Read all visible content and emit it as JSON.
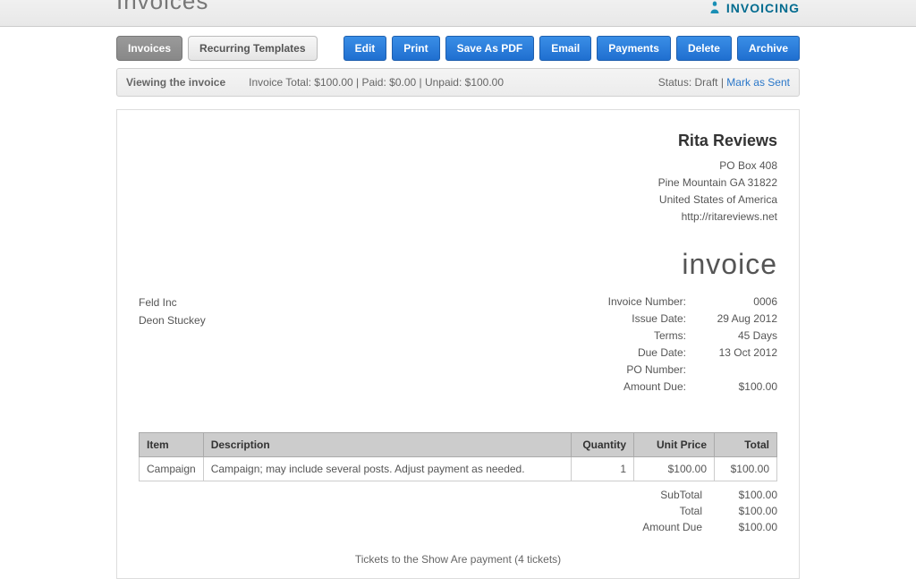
{
  "header": {
    "page_title": "Invoices",
    "brand": "INVOICING"
  },
  "tabs": {
    "invoices": "Invoices",
    "recurring": "Recurring Templates"
  },
  "actions": {
    "edit": "Edit",
    "print": "Print",
    "save_pdf": "Save As PDF",
    "email": "Email",
    "payments": "Payments",
    "delete": "Delete",
    "archive": "Archive"
  },
  "infobar": {
    "viewing": "Viewing the invoice",
    "totals": "Invoice Total: $100.00 | Paid: $0.00 | Unpaid: $100.00",
    "status_label": "Status: ",
    "status_value": "Draft",
    "sep": " | ",
    "mark_as_sent": "Mark as Sent"
  },
  "company": {
    "name": "Rita Reviews",
    "line1": "PO Box 408",
    "line2": "Pine Mountain GA 31822",
    "line3": "United States of America",
    "url": "http://ritareviews.net"
  },
  "invoice_heading": "invoice",
  "bill_to": {
    "company": "Feld Inc",
    "contact": "Deon Stuckey"
  },
  "meta": {
    "invoice_number_label": "Invoice Number:",
    "invoice_number": "0006",
    "issue_date_label": "Issue Date:",
    "issue_date": "29 Aug 2012",
    "terms_label": "Terms:",
    "terms": "45 Days",
    "due_date_label": "Due Date:",
    "due_date": "13 Oct 2012",
    "po_number_label": "PO Number:",
    "po_number": "",
    "amount_due_label": "Amount Due:",
    "amount_due": "$100.00"
  },
  "items_header": {
    "item": "Item",
    "description": "Description",
    "quantity": "Quantity",
    "unit_price": "Unit Price",
    "total": "Total"
  },
  "items": [
    {
      "item": "Campaign",
      "description": "Campaign; may include several posts. Adjust payment as needed.",
      "quantity": "1",
      "unit_price": "$100.00",
      "total": "$100.00"
    }
  ],
  "totals": {
    "subtotal_label": "SubTotal",
    "subtotal": "$100.00",
    "total_label": "Total",
    "total": "$100.00",
    "amount_due_label": "Amount Due",
    "amount_due": "$100.00"
  },
  "footer_note": "Tickets to the Show Are payment (4 tickets)"
}
